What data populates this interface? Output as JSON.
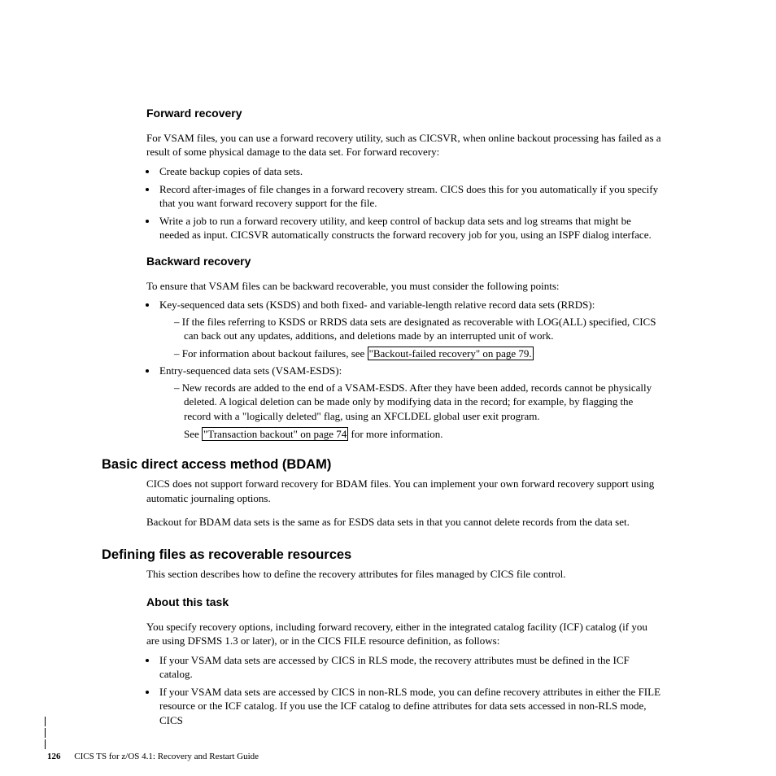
{
  "section_forward": {
    "title": "Forward recovery",
    "intro": "For VSAM files, you can use a forward recovery utility, such as CICSVR, when online backout processing has failed as a result of some physical damage to the data set. For forward recovery:",
    "items": [
      "Create backup copies of data sets.",
      "Record after-images of file changes in a forward recovery stream. CICS does this for you automatically if you specify that you want forward recovery support for the file.",
      "Write a job to run a forward recovery utility, and keep control of backup data sets and log streams that might be needed as input. CICSVR automatically constructs the forward recovery job for you, using an ISPF dialog interface."
    ]
  },
  "section_backward": {
    "title": "Backward recovery",
    "intro": "To ensure that VSAM files can be backward recoverable, you must consider the following points:",
    "item1": "Key-sequenced data sets (KSDS) and both fixed- and variable-length relative record data sets (RRDS):",
    "item1_sub1": "If the files referring to KSDS or RRDS data sets are designated as recoverable with LOG(ALL) specified, CICS can back out any updates, additions, and deletions made by an interrupted unit of work.",
    "item1_sub2_pre": "For information about backout failures, see ",
    "item1_sub2_link": "\"Backout-failed recovery\" on page 79.",
    "item2": "Entry-sequenced data sets (VSAM-ESDS):",
    "item2_sub1": "New records are added to the end of a VSAM-ESDS. After they have been added, records cannot be physically deleted. A logical deletion can be made only by modifying data in the record; for example, by flagging the record with a \"logically deleted\" flag, using an XFCLDEL global user exit program.",
    "item2_see_pre": "See ",
    "item2_see_link": "\"Transaction backout\" on page 74",
    "item2_see_post": " for more information."
  },
  "section_bdam": {
    "title": "Basic direct access method (BDAM)",
    "p1": "CICS does not support forward recovery for BDAM files. You can implement your own forward recovery support using automatic journaling options.",
    "p2": "Backout for BDAM data sets is the same as for ESDS data sets in that you cannot delete records from the data set."
  },
  "section_defining": {
    "title": "Defining files as recoverable resources",
    "intro": "This section describes how to define the recovery attributes for files managed by CICS file control.",
    "about_title": "About this task",
    "about_intro": "You specify recovery options, including forward recovery, either in the integrated catalog facility (ICF) catalog (if you are using DFSMS 1.3 or later), or in the CICS FILE resource definition, as follows:",
    "items": [
      "If your VSAM data sets are accessed by CICS in RLS mode, the recovery attributes must be defined in the ICF catalog.",
      "If your VSAM data sets are accessed by CICS in non-RLS mode, you can define recovery attributes in either the FILE resource or the ICF catalog. If you use the ICF catalog to define attributes for data sets accessed in non-RLS mode, CICS"
    ]
  },
  "footer": {
    "page": "126",
    "text": "CICS TS for z/OS 4.1: Recovery and Restart Guide"
  }
}
